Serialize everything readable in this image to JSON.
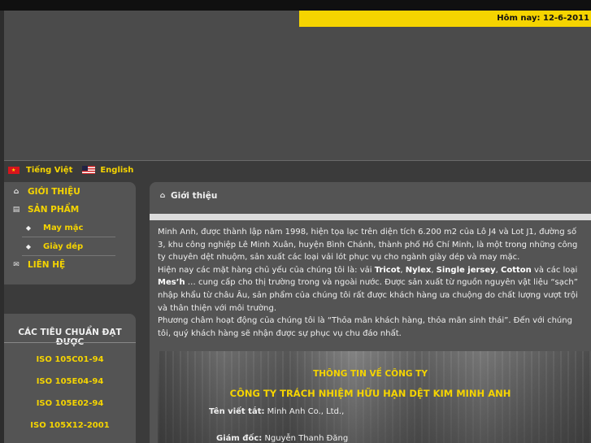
{
  "header": {
    "date_text": "Hôm nay: 12-6-2011"
  },
  "languages": {
    "vi": "Tiếng Việt",
    "en": "English"
  },
  "sidebar": {
    "menu": [
      {
        "label": "GIỚI THIỆU",
        "icon": "home-icon"
      },
      {
        "label": "SẢN PHẨM",
        "icon": "products-icon",
        "children": [
          "May mặc",
          "Giày dép"
        ]
      },
      {
        "label": "LIÊN HỆ",
        "icon": "mail-icon"
      }
    ]
  },
  "standards": {
    "title": "CÁC TIÊU CHUẨN ĐẠT ĐƯỢC",
    "items": [
      "ISO 105C01-94",
      "ISO 105E04-94",
      "ISO 105E02-94",
      "ISO 105X12-2001"
    ]
  },
  "main": {
    "title": "Giới thiệu",
    "para1": "Minh Anh, được thành lập năm 1998, hiện tọa lạc trên diện tích 6.200 m2 của Lô J4 và Lot J1, đường số 3, khu công nghiệp Lê Minh Xuân, huyện Bình Chánh, thành phố Hồ Chí Minh, là một trong những công ty chuyên dệt nhuộm, sản xuất các loại vải lót phục vụ cho ngành giày dép và may mặc.",
    "para2": {
      "intro": "Hiện nay các mặt hàng chủ yếu của chúng tôi là: vải ",
      "products": [
        "Tricot",
        "Nylex",
        "Single jersey",
        "Cotton",
        "Mes’h"
      ],
      "sep": ", ",
      "and_text": " và các loại ",
      "rest": " … cung cấp cho thị trường trong và ngoài nước. Được sản xuất từ nguồn nguyên vật liệu “sạch” nhập khẩu từ châu Âu, sản phẩm của chúng tôi rất được khách hàng ưa chuộng do chất lượng vượt trội và thân thiện với môi trường."
    },
    "para3": "Phương châm hoạt động của chúng tôi là “Thỏa mãn khách hàng, thỏa mãn sinh thái”. Đến với chúng tôi, quý khách hàng sẽ nhận được sự phục vụ chu đáo nhất.",
    "info_title": "THÔNG TIN VỀ CÔNG TY",
    "company_name": "CÔNG TY TRÁCH NHIỆM HỮU HẠN DỆT KIM MINH ANH",
    "short_name_label": "Tên viết tắt:",
    "short_name_value": "Minh Anh Co., Ltd.,",
    "director_label": "Giám đốc:",
    "director_value": "Nguyễn Thanh Đăng"
  },
  "colors": {
    "accent": "#f5d400",
    "background": "#3b3b3b",
    "panel": "#545454"
  }
}
